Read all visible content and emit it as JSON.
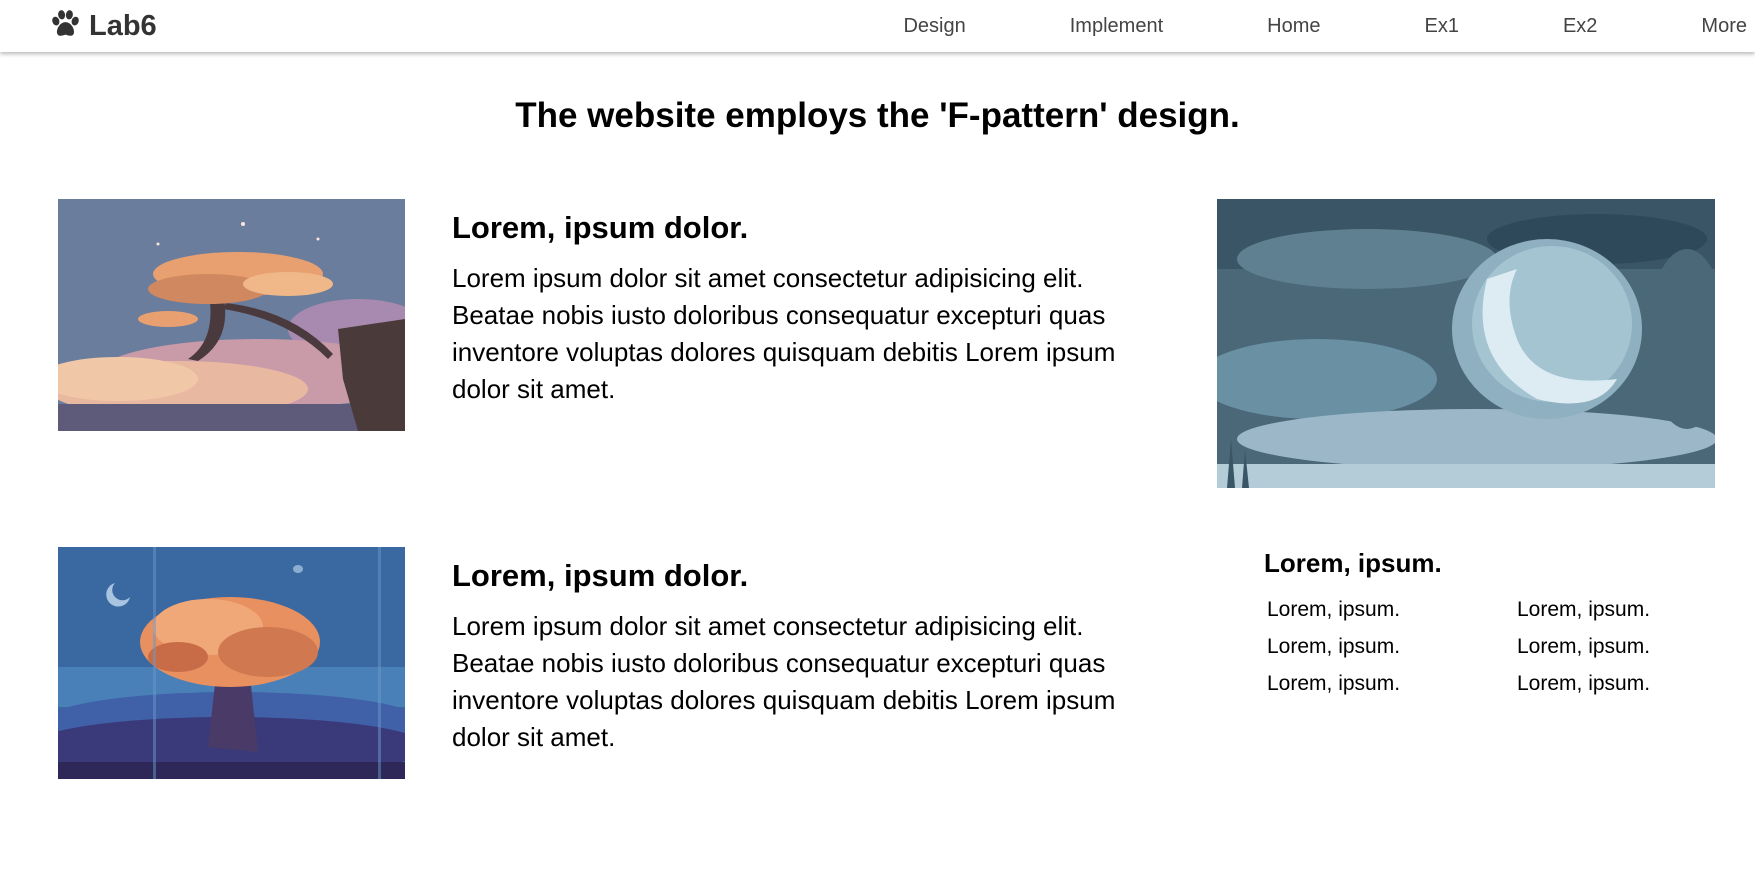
{
  "brand": {
    "name": "Lab6",
    "icon": "paw-icon"
  },
  "nav": {
    "links": [
      "Design",
      "Implement",
      "Home",
      "Ex1",
      "Ex2",
      "More"
    ]
  },
  "page": {
    "title": "The website employs the 'F-pattern' design."
  },
  "articles": [
    {
      "heading": "Lorem, ipsum dolor.",
      "body": "Lorem ipsum dolor sit amet consectetur adipisicing elit. Beatae nobis iusto doloribus consequatur excepturi quas inventore voluptas dolores quisquam debitis Lorem ipsum dolor sit amet."
    },
    {
      "heading": "Lorem, ipsum dolor.",
      "body": "Lorem ipsum dolor sit amet consectetur adipisicing elit. Beatae nobis iusto doloribus consequatur excepturi quas inventore voluptas dolores quisquam debitis Lorem ipsum dolor sit amet."
    }
  ],
  "side_list": {
    "heading": "Lorem, ipsum.",
    "items": [
      "Lorem, ipsum.",
      "Lorem, ipsum.",
      "Lorem, ipsum.",
      "Lorem, ipsum.",
      "Lorem, ipsum.",
      "Lorem, ipsum."
    ]
  },
  "colors": {
    "nav_text": "#444444",
    "brand_text": "#333333",
    "background": "#ffffff"
  }
}
